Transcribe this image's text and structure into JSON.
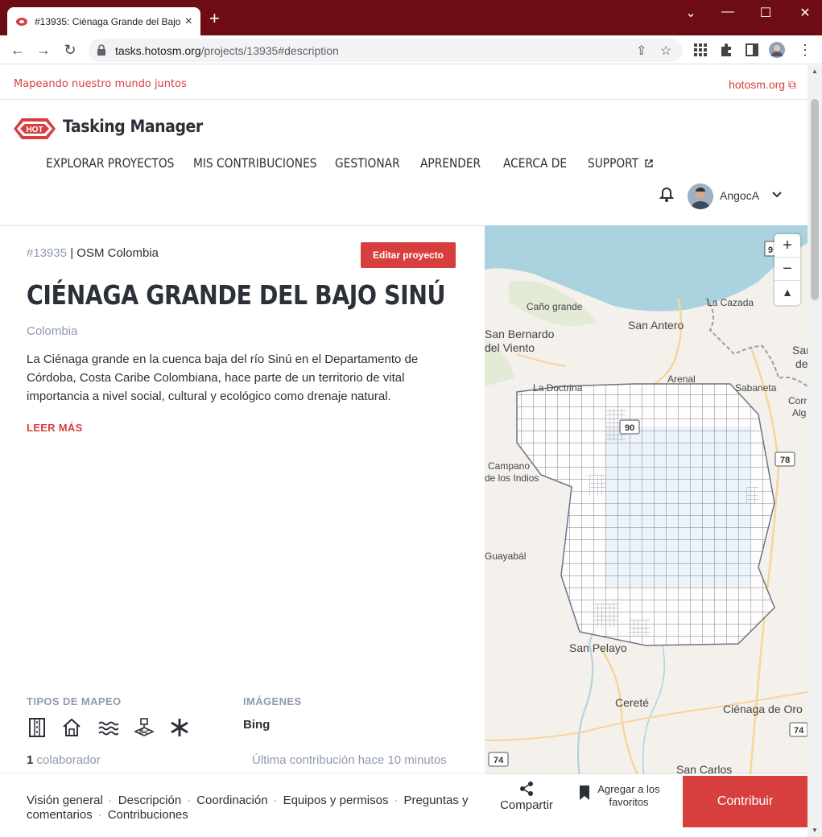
{
  "browser": {
    "tab_title": "#13935: Ciénaga Grande del Bajo Sinú",
    "new_tab": "+",
    "url_host": "tasks.hotosm.org",
    "url_path": "/projects/13935#description",
    "window_controls": [
      "minimize-icon",
      "maximize-icon",
      "close-icon"
    ]
  },
  "topbar": {
    "tagline": "Mapeando nuestro mundo juntos",
    "external_link": "hotosm.org"
  },
  "header": {
    "brand": "Tasking Manager",
    "logo_text": "HOT",
    "menu": [
      "EXPLORAR PROYECTOS",
      "MIS CONTRIBUCIONES",
      "GESTIONAR",
      "APRENDER",
      "ACERCA DE",
      "SUPPORT"
    ],
    "username": "AngocA"
  },
  "project": {
    "id": "#13935",
    "org": "OSM Colombia",
    "edit_label": "Editar proyecto",
    "title": "CIÉNAGA GRANDE DEL BAJO SINÚ",
    "country": "Colombia",
    "description": "La Ciénaga grande en la cuenca baja del río Sinú en el Departamento de Córdoba, Costa Caribe Colombiana, hace parte de un territorio de vital importancia a nivel social, cultural y ecológico como drenaje natural.",
    "read_more": "LEER MÁS",
    "mapping_types_label": "TIPOS DE MAPEO",
    "mapping_types": [
      "roads-icon",
      "buildings-icon",
      "waterways-icon",
      "landuse-icon",
      "other-icon"
    ],
    "imagery_label": "IMÁGENES",
    "imagery": "Bing",
    "contributors_count": "1",
    "contributors_label": "colaborador",
    "last_contribution": "Última contribución hace 10 minutos"
  },
  "map": {
    "labels": [
      "Caño grande",
      "San Antero",
      "La Cazada",
      "San Bernardo",
      "del Viento",
      "La Doctrina",
      "Arenal",
      "Sabaneta",
      "Campano",
      "de los Indios",
      "Guayabál",
      "San Pelayo",
      "Cereté",
      "Ciénaga de Oro",
      "San Carlos",
      "Sar",
      "de",
      "Corr",
      "Alg",
      "9"
    ],
    "road_shields": [
      "90",
      "78",
      "74",
      "74"
    ],
    "zoom_in": "+",
    "zoom_out": "−",
    "compass": "▲"
  },
  "bottom": {
    "nav": [
      "Visión general",
      "Descripción",
      "Coordinación",
      "Equipos y permisos",
      "Preguntas y comentarios",
      "Contribuciones"
    ],
    "share": "Compartir",
    "favorite": "Agregar a los favoritos",
    "contribute": "Contribuir"
  },
  "colors": {
    "brand_red": "#d73f3f",
    "titlebar": "#6e0c13",
    "muted": "#8f9bad",
    "text": "#2c3038"
  }
}
